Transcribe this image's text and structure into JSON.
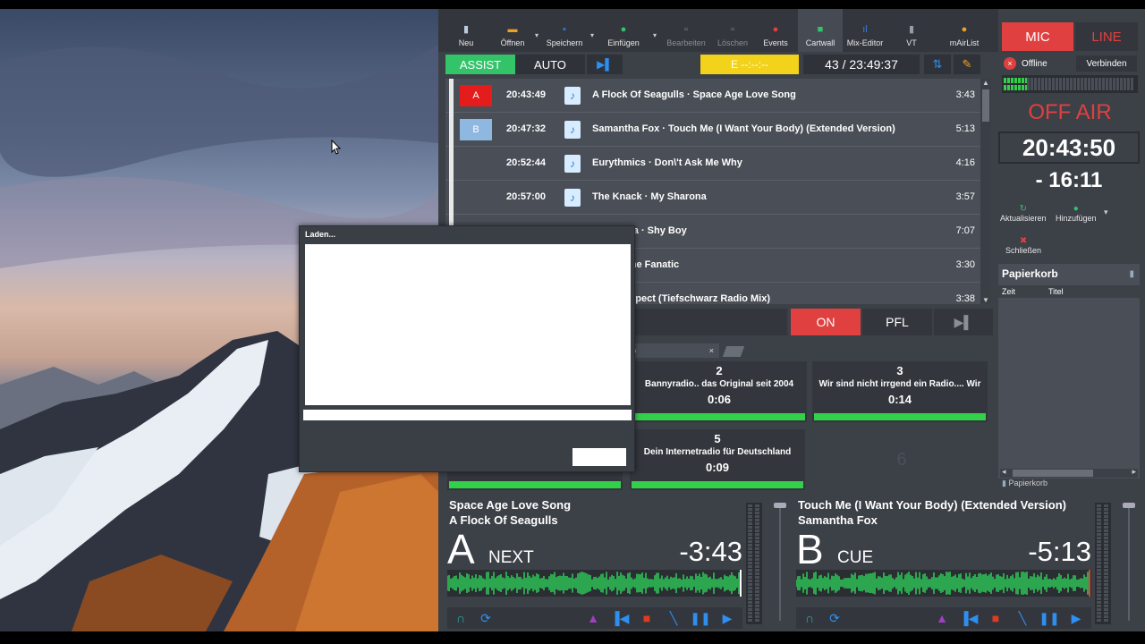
{
  "toolbar": {
    "buttons": [
      {
        "label": "Neu"
      },
      {
        "label": "Öffnen"
      },
      {
        "label": "Speichern"
      },
      {
        "label": "Einfügen"
      },
      {
        "label": "Bearbeiten"
      },
      {
        "label": "Löschen"
      },
      {
        "label": "Events"
      },
      {
        "label": "Cartwall"
      },
      {
        "label": "Mix-Editor"
      },
      {
        "label": "VT"
      },
      {
        "label": "mAirList"
      }
    ]
  },
  "modes": {
    "assist": "ASSIST",
    "auto": "AUTO",
    "event": "E --:--:--",
    "counter": "43 / 23:49:37"
  },
  "playlist": [
    {
      "slot": "A",
      "time": "20:43:49",
      "title": "A Flock Of Seagulls · Space Age Love Song",
      "duration": "3:43"
    },
    {
      "slot": "B",
      "time": "20:47:32",
      "title": "Samantha Fox · Touch Me (I Want Your Body) (Extended Version)",
      "duration": "5:13"
    },
    {
      "slot": "",
      "time": "20:52:44",
      "title": "Eurythmics · Don\\'t Ask Me Why",
      "duration": "4:16"
    },
    {
      "slot": "",
      "time": "20:57:00",
      "title": "The Knack · My Sharona",
      "duration": "3:57"
    },
    {
      "slot": "",
      "time": "",
      "title": "ma · Shy Boy",
      "duration": "7:07"
    },
    {
      "slot": "",
      "time": "",
      "title": "The Fanatic",
      "duration": "3:30"
    },
    {
      "slot": "",
      "time": "",
      "title": "espect (Tiefschwarz Radio Mix)",
      "duration": "3:38"
    }
  ],
  "onair_buttons": {
    "on": "ON",
    "pfl": "PFL"
  },
  "cartwall": {
    "tab_label": "lo",
    "carts": [
      {
        "num": "2",
        "label": "Bannyradio.. das Original seit 2004",
        "time": "0:06"
      },
      {
        "num": "3",
        "label": "Wir sind nicht irrgend ein Radio.... Wir",
        "time": "0:14"
      },
      {
        "num": "5",
        "label": "Dein Internetradio für Deutschland",
        "time": "0:09"
      },
      {
        "num": "6",
        "label": "",
        "time": ""
      }
    ]
  },
  "right": {
    "mic": "MIC",
    "line": "LINE",
    "offline": "Offline",
    "verbinden": "Verbinden",
    "offair": "OFF AIR",
    "clock": "20:43:50",
    "remaining": "- 16:11",
    "aktualisieren": "Aktualisieren",
    "hinzufuegen": "Hinzufügen",
    "schliessen": "Schließen",
    "papierkorb": "Papierkorb",
    "col_zeit": "Zeit",
    "col_titel": "Titel",
    "papierkorb_tab": "Papierkorb"
  },
  "players": [
    {
      "letter": "A",
      "title": "Space Age Love Song",
      "artist": "A Flock Of Seagulls",
      "state": "NEXT",
      "countdown": "-3:43"
    },
    {
      "letter": "B",
      "title": "Touch Me (I Want Your Body) (Extended Version)",
      "artist": "Samantha Fox",
      "state": "CUE",
      "countdown": "-5:13"
    }
  ],
  "dialog": {
    "title": "Laden..."
  },
  "colors": {
    "accent_green": "#33c46a",
    "onair_red": "#e04040",
    "event_yellow": "#f2d21a",
    "link_blue": "#2e8ff0"
  }
}
